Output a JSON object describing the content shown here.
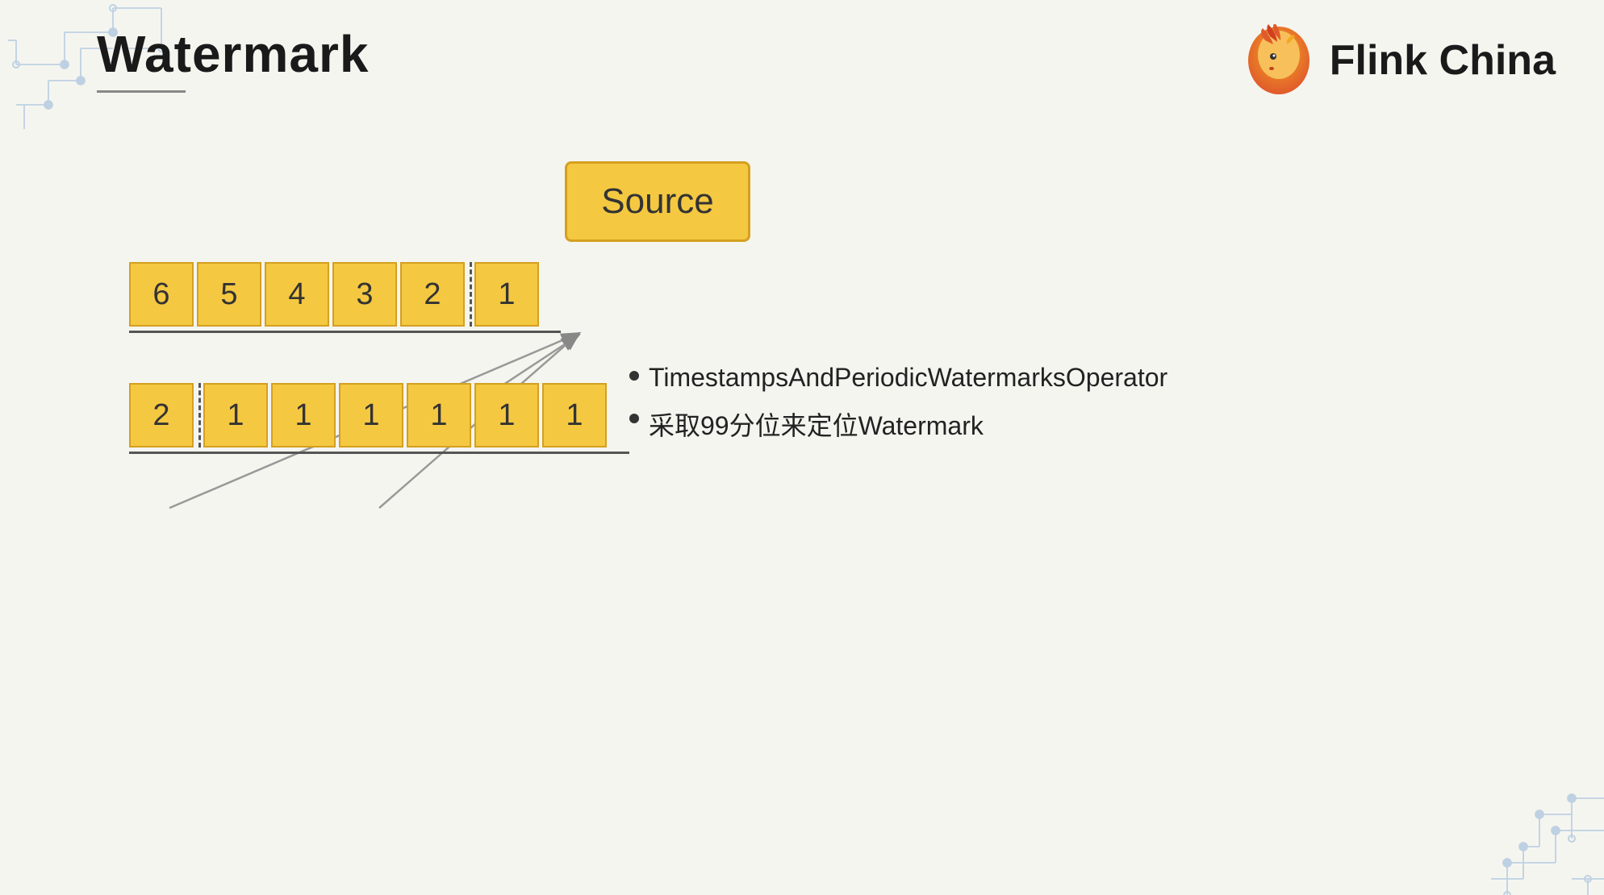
{
  "page": {
    "title": "Watermark",
    "background_color": "#f5f5f0"
  },
  "logo": {
    "text": "Flink China"
  },
  "source_box": {
    "label": "Source"
  },
  "row1": {
    "values": [
      6,
      5,
      4,
      3,
      2,
      1
    ]
  },
  "row2": {
    "values": [
      2,
      1,
      1,
      1,
      1,
      1,
      1
    ]
  },
  "bullets": [
    "TimestampsAndPeriodicWatermarksOperator",
    "采取99分位来定位Watermark"
  ]
}
